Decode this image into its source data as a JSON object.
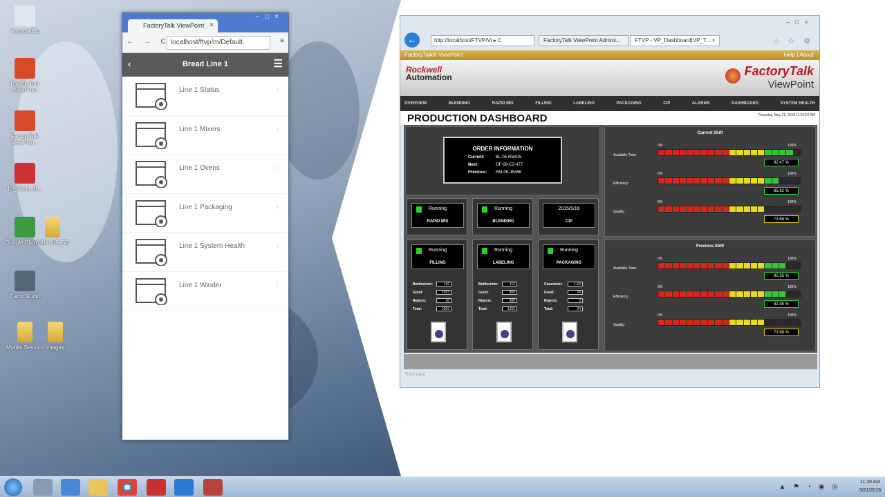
{
  "desktop": {
    "icons": [
      {
        "label": "Recycle Bin",
        "color": "#dfe6ee"
      },
      {
        "label": "FactoryTalk ViewPoint",
        "color": "#d94a2b"
      },
      {
        "label": "FactoryTalk ViewPoin...",
        "color": "#d94a2b"
      },
      {
        "label": "IE_Client_B...",
        "color": "#c33"
      },
      {
        "label": "Google Chrome",
        "color": "#3c9b3f"
      },
      {
        "label": "6.1build9_SE",
        "color": ""
      },
      {
        "label": "Camt Studio",
        "color": "#567"
      },
      {
        "label": "Mobile Session",
        "color": ""
      },
      {
        "label": "images",
        "color": ""
      }
    ]
  },
  "chrome": {
    "tab_title": "FactoryTalk ViewPoint",
    "tab_close": "×",
    "window_controls": "–□×",
    "nav": "← → C",
    "url": "localhost/ftvp/m/Default.",
    "menu": "≡",
    "header_title": "Bread Line 1",
    "back": "‹",
    "hamburger": "☰",
    "items": [
      {
        "label": "Line 1  Status"
      },
      {
        "label": "Line 1 Mixers"
      },
      {
        "label": "Line 1 Ovens"
      },
      {
        "label": "Line 1 Packaging"
      },
      {
        "label": "Line 1 System Health"
      },
      {
        "label": "Line 1 Winder"
      }
    ],
    "arrow": "›"
  },
  "ie": {
    "back": "←",
    "url": "http://localhost/FTVP/Vi ▸ C",
    "tabs": [
      {
        "label": "FactoryTalk ViewPoint Admini..."
      },
      {
        "label": "FTVP - VP_Dashboard|VP_T... ×"
      }
    ],
    "window_controls": "–□×",
    "fav_icons": "⌂ ☆ ⚙",
    "app_label": "FactoryTalk® ViewPoint",
    "links": "Help | About",
    "ra_line1": "Rockwell",
    "ra_line2": "Automation",
    "ftv_line1": "FactoryTalk",
    "ftv_line2": "ViewPoint",
    "nav": [
      "OVERVIEW",
      "BLENDING",
      "RAPID MIX",
      "FILLING",
      "LABELING",
      "PACKAGING",
      "CIP",
      "ALARMS",
      "DASHBOARD",
      "SYSTEM HEALTH"
    ],
    "page_title": "PRODUCTION DASHBOARD",
    "date": "Thursday, May 21, 2015 11:20:02 AM",
    "order": {
      "title": "ORDER INFORMATION",
      "rows": [
        {
          "k": "Current:",
          "v": "BL-05-RM415"
        },
        {
          "k": "Next:",
          "v": "OF-08-CZ-477"
        },
        {
          "k": "Previous:",
          "v": "RM-05-JB456"
        }
      ]
    },
    "units_top": [
      {
        "status": "Running",
        "name": "RAPID MIX",
        "light": true
      },
      {
        "status": "Running",
        "name": "BLENDING",
        "light": true
      },
      {
        "status": "2015/5/16",
        "name": "CIP",
        "light": false
      }
    ],
    "units_bottom": [
      {
        "status": "Running",
        "name": "FILLING",
        "counts": [
          {
            "k": "Bottles/min:",
            "v": "116"
          },
          {
            "k": "Good:",
            "v": "1553"
          },
          {
            "k": "Rejects:",
            "v": "16"
          },
          {
            "k": "Total:",
            "v": "1603"
          }
        ]
      },
      {
        "status": "Running",
        "name": "LABELING",
        "counts": [
          {
            "k": "Bottles/min:",
            "v": "113"
          },
          {
            "k": "Good:",
            "v": "800"
          },
          {
            "k": "Rejects:",
            "v": "380"
          },
          {
            "k": "Total:",
            "v": "1650"
          }
        ]
      },
      {
        "status": "Running",
        "name": "PACKAGING",
        "counts": [
          {
            "k": "Cases/min:",
            "v": "1.63"
          },
          {
            "k": "Good:",
            "v": "24"
          },
          {
            "k": "Rejects:",
            "v": "0"
          },
          {
            "k": "Total:",
            "v": "24"
          }
        ]
      }
    ],
    "current_shift": {
      "title": "Current Shift",
      "metrics": [
        {
          "label": "Available Time:",
          "value": "92.47 %",
          "fraction": 0.925,
          "ok": true
        },
        {
          "label": "Efficiency:",
          "value": "85.92 %",
          "fraction": 0.86,
          "ok": true
        },
        {
          "label": "Quality:",
          "value": "73.68 %",
          "fraction": 0.74,
          "ok": false
        }
      ]
    },
    "previous_shift": {
      "title": "Previous Shift",
      "metrics": [
        {
          "label": "Available Time:",
          "value": "92.35 %",
          "fraction": 0.92,
          "ok": true
        },
        {
          "label": "Efficiency:",
          "value": "92.35 %",
          "fraction": 0.92,
          "ok": true
        },
        {
          "label": "Quality:",
          "value": "73.68 %",
          "fraction": 0.74,
          "ok": false
        }
      ]
    },
    "zero": "0%",
    "hundred": "100%",
    "status": "Total data"
  },
  "taskbar": {
    "time": "11:20 AM",
    "date": "5/21/2015",
    "tray": "▲ ⚑ ◔ ◉ ◎"
  },
  "colors": {
    "red": "#d9261c",
    "yellow": "#e8dc12",
    "green": "#35c43a",
    "empty": "#2a2a2a"
  }
}
